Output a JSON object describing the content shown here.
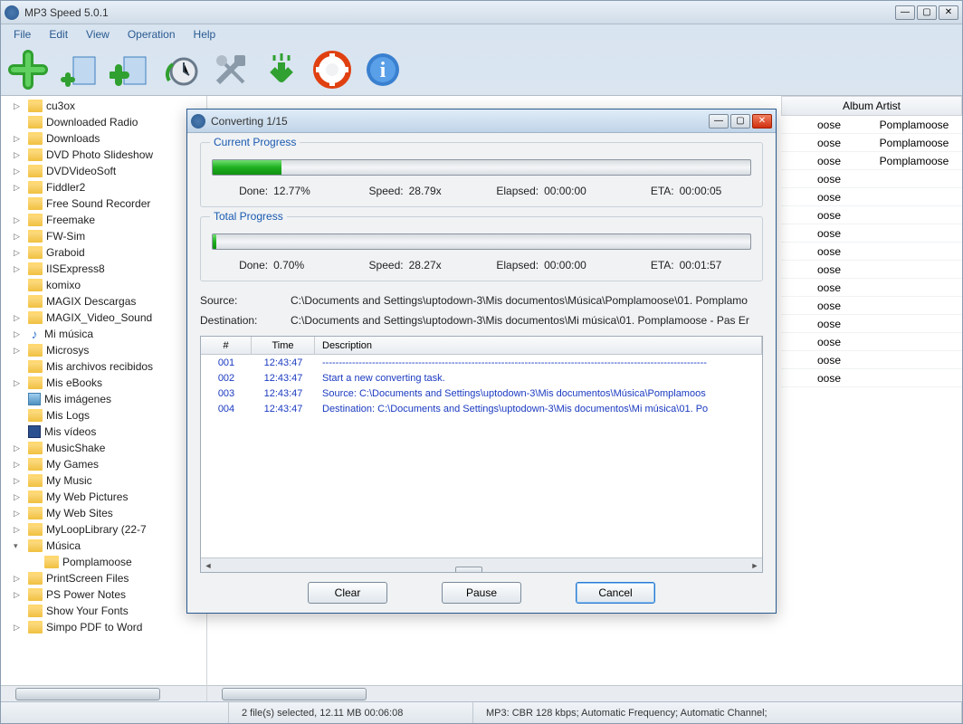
{
  "main": {
    "title": "MP3 Speed 5.0.1",
    "menu": [
      "File",
      "Edit",
      "View",
      "Operation",
      "Help"
    ],
    "toolbar": [
      "add",
      "add-folder",
      "add-list",
      "timer",
      "tools",
      "download",
      "help",
      "info"
    ]
  },
  "tree": [
    {
      "label": "cu3ox",
      "icon": "folder",
      "exp": ">"
    },
    {
      "label": "Downloaded Radio",
      "icon": "folder"
    },
    {
      "label": "Downloads",
      "icon": "folder",
      "exp": ">"
    },
    {
      "label": "DVD Photo Slideshow",
      "icon": "folder",
      "exp": ">"
    },
    {
      "label": "DVDVideoSoft",
      "icon": "folder",
      "exp": ">"
    },
    {
      "label": "Fiddler2",
      "icon": "folder",
      "exp": ">"
    },
    {
      "label": "Free Sound Recorder",
      "icon": "folder"
    },
    {
      "label": "Freemake",
      "icon": "folder",
      "exp": ">"
    },
    {
      "label": "FW-Sim",
      "icon": "folder",
      "exp": ">"
    },
    {
      "label": "Graboid",
      "icon": "folder",
      "exp": ">"
    },
    {
      "label": "IISExpress8",
      "icon": "folder",
      "exp": ">"
    },
    {
      "label": "komixo",
      "icon": "folder"
    },
    {
      "label": "MAGIX Descargas",
      "icon": "folder"
    },
    {
      "label": "MAGIX_Video_Sound",
      "icon": "folder",
      "exp": ">"
    },
    {
      "label": "Mi música",
      "icon": "music",
      "exp": ">"
    },
    {
      "label": "Microsys",
      "icon": "folder",
      "exp": ">"
    },
    {
      "label": "Mis archivos recibidos",
      "icon": "folder"
    },
    {
      "label": "Mis eBooks",
      "icon": "folder",
      "exp": ">"
    },
    {
      "label": "Mis imágenes",
      "icon": "pic"
    },
    {
      "label": "Mis Logs",
      "icon": "folder"
    },
    {
      "label": "Mis vídeos",
      "icon": "vid"
    },
    {
      "label": "MusicShake",
      "icon": "folder",
      "exp": ">"
    },
    {
      "label": "My Games",
      "icon": "folder",
      "exp": ">"
    },
    {
      "label": "My Music",
      "icon": "folder",
      "exp": ">"
    },
    {
      "label": "My Web Pictures",
      "icon": "folder",
      "exp": ">"
    },
    {
      "label": "My Web Sites",
      "icon": "folder",
      "exp": ">"
    },
    {
      "label": "MyLoopLibrary (22-7",
      "icon": "folder",
      "exp": ">"
    },
    {
      "label": "Música",
      "icon": "folder",
      "exp": "▾"
    },
    {
      "label": "Pomplamoose",
      "icon": "folder",
      "sub": true
    },
    {
      "label": "PrintScreen Files",
      "icon": "folder",
      "exp": ">"
    },
    {
      "label": "PS Power Notes",
      "icon": "folder",
      "exp": ">"
    },
    {
      "label": "Show Your Fonts",
      "icon": "folder"
    },
    {
      "label": "Simpo PDF to Word",
      "icon": "folder",
      "exp": ">"
    }
  ],
  "list": {
    "header": "Album Artist",
    "rows_visible": [
      {
        "suffix": "oose",
        "artist": "Pomplamoose"
      },
      {
        "suffix": "oose",
        "artist": "Pomplamoose"
      },
      {
        "suffix": "oose",
        "artist": "Pomplamoose"
      },
      {
        "suffix": "oose",
        "artist": ""
      },
      {
        "suffix": "oose",
        "artist": ""
      },
      {
        "suffix": "oose",
        "artist": ""
      },
      {
        "suffix": "oose",
        "artist": ""
      },
      {
        "suffix": "oose",
        "artist": ""
      },
      {
        "suffix": "oose",
        "artist": ""
      },
      {
        "suffix": "oose",
        "artist": ""
      },
      {
        "suffix": "oose",
        "artist": ""
      },
      {
        "suffix": "oose",
        "artist": ""
      },
      {
        "suffix": "oose",
        "artist": ""
      },
      {
        "suffix": "oose",
        "artist": ""
      },
      {
        "suffix": "oose",
        "artist": ""
      }
    ]
  },
  "status": {
    "seg1": "2 file(s) selected, 12.11 MB   00:06:08",
    "seg2": "MP3:  CBR 128 kbps; Automatic Frequency; Automatic Channel;"
  },
  "dialog": {
    "title": "Converting 1/15",
    "current": {
      "legend": "Current Progress",
      "done_lbl": "Done:",
      "done": "12.77%",
      "pct": 12.77,
      "speed_lbl": "Speed:",
      "speed": "28.79x",
      "elapsed_lbl": "Elapsed:",
      "elapsed": "00:00:00",
      "eta_lbl": "ETA:",
      "eta": "00:00:05"
    },
    "total": {
      "legend": "Total Progress",
      "done_lbl": "Done:",
      "done": "0.70%",
      "pct": 0.7,
      "speed_lbl": "Speed:",
      "speed": "28.27x",
      "elapsed_lbl": "Elapsed:",
      "elapsed": "00:00:00",
      "eta_lbl": "ETA:",
      "eta": "00:01:57"
    },
    "source_lbl": "Source:",
    "source": "C:\\Documents and Settings\\uptodown-3\\Mis documentos\\Música\\Pomplamoose\\01. Pomplamo",
    "dest_lbl": "Destination:",
    "dest": "C:\\Documents and Settings\\uptodown-3\\Mis documentos\\Mi música\\01. Pomplamoose - Pas Er",
    "log": {
      "cols": [
        "#",
        "Time",
        "Description"
      ],
      "rows": [
        {
          "no": "001",
          "time": "12:43:47",
          "desc": "--------------------------------------------------------------------------------------------------------------------"
        },
        {
          "no": "002",
          "time": "12:43:47",
          "desc": "Start a new converting task."
        },
        {
          "no": "003",
          "time": "12:43:47",
          "desc": "Source:  C:\\Documents and Settings\\uptodown-3\\Mis documentos\\Música\\Pomplamoos"
        },
        {
          "no": "004",
          "time": "12:43:47",
          "desc": "Destination: C:\\Documents and Settings\\uptodown-3\\Mis documentos\\Mi música\\01. Po"
        }
      ]
    },
    "buttons": {
      "clear": "Clear",
      "pause": "Pause",
      "cancel": "Cancel"
    }
  }
}
